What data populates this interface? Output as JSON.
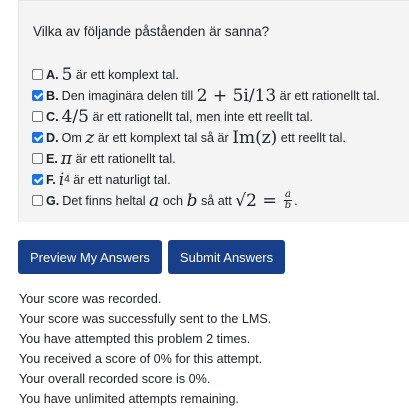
{
  "question": "Vilka av följande påståenden är sanna?",
  "options": [
    {
      "letter": "A.",
      "checked": false,
      "m1": "5",
      "t1": " är ett komplext tal."
    },
    {
      "letter": "B.",
      "checked": true,
      "t0": "Den imaginära delen till ",
      "m1": "2 + 5i/13",
      "t1": " är ett rationellt tal."
    },
    {
      "letter": "C.",
      "checked": false,
      "m1": "4/5",
      "t1": " är ett rationellt tal, men inte ett reellt tal."
    },
    {
      "letter": "D.",
      "checked": true,
      "t0": "Om ",
      "m1": "z",
      "t1": " är ett komplext tal så är ",
      "m2": "Im(z)",
      "t2": " ett reellt tal."
    },
    {
      "letter": "E.",
      "checked": false,
      "m1": "π",
      "t1": " är ett rationellt tal."
    },
    {
      "letter": "F.",
      "checked": true,
      "m1": "i",
      "sup": "4",
      "t1": " är ett naturligt tal."
    },
    {
      "letter": "G.",
      "checked": false,
      "t0": "Det finns heltal ",
      "m1": "a",
      "t1": " och ",
      "m2": "b",
      "t2": " så att ",
      "m3": "√2 = ",
      "fnum": "a",
      "fden": "b",
      "t3": "."
    }
  ],
  "buttons": {
    "preview": "Preview My Answers",
    "submit": "Submit Answers"
  },
  "messages": [
    "Your score was recorded.",
    "Your score was successfully sent to the LMS.",
    "You have attempted this problem 2 times.",
    "You received a score of 0% for this attempt.",
    "Your overall recorded score is 0%.",
    "You have unlimited attempts remaining."
  ]
}
